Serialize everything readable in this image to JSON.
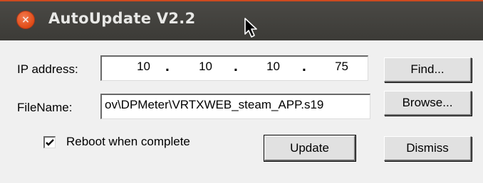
{
  "window": {
    "title": "AutoUpdate V2.2",
    "close_icon": "×"
  },
  "ip": {
    "label": "IP address:",
    "octets": [
      "10",
      "10",
      "10",
      "75"
    ],
    "separator": "."
  },
  "file": {
    "label": "FileName:",
    "value": "ov\\DPMeter\\VRTXWEB_steam_APP.s19"
  },
  "reboot": {
    "label": "Reboot when complete",
    "checked": true
  },
  "buttons": {
    "find": "Find...",
    "browse": "Browse...",
    "update": "Update",
    "dismiss": "Dismiss"
  },
  "colors": {
    "titlebar": "#3c3b37",
    "close": "#df4b16",
    "dialog": "#f0f0f0"
  }
}
